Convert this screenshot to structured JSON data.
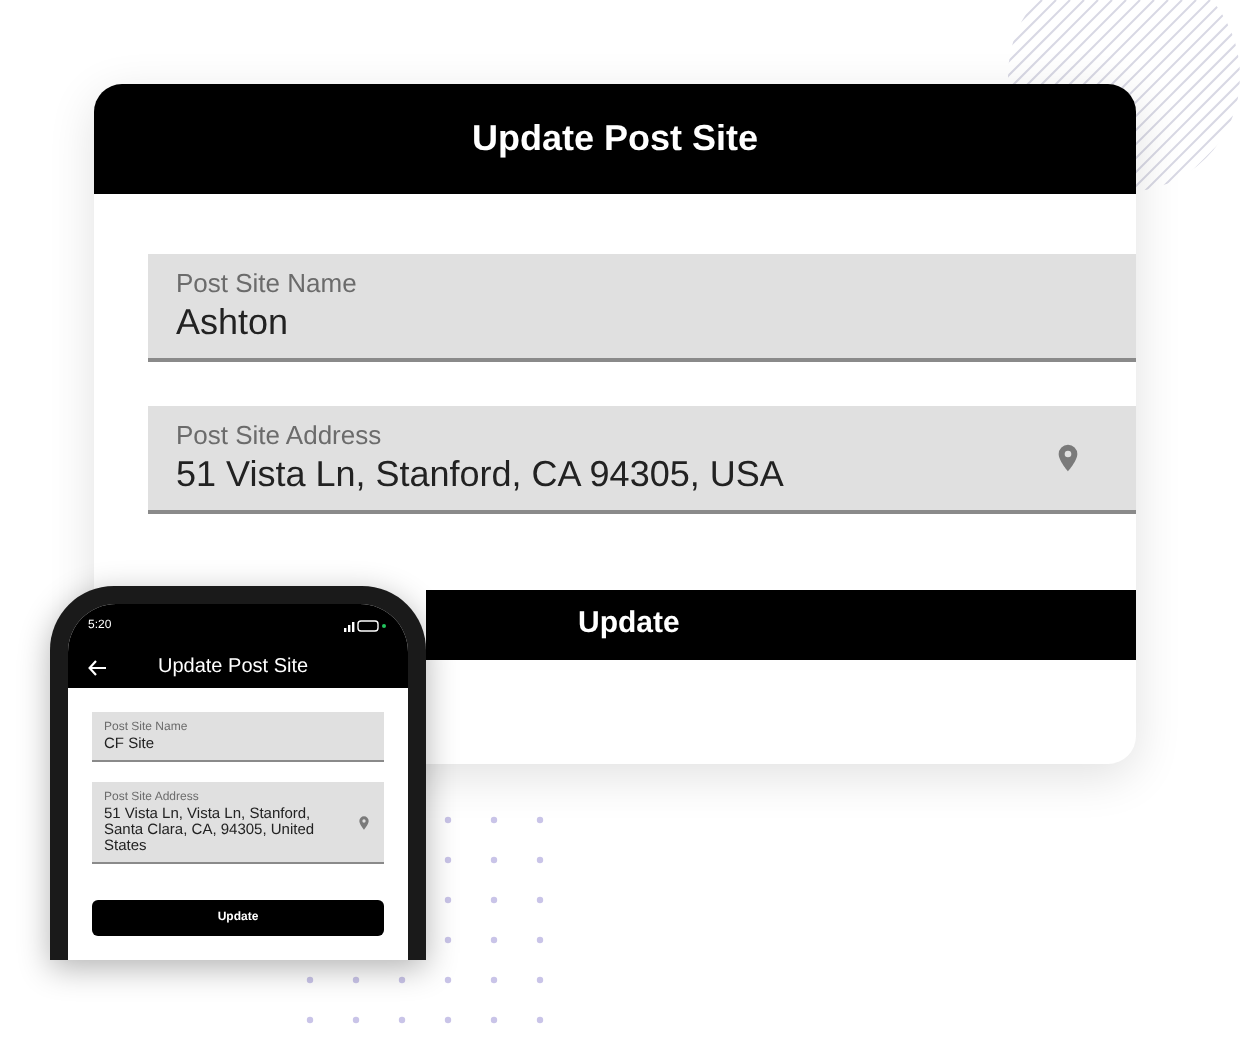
{
  "desktop": {
    "title": "Update Post Site",
    "fields": [
      {
        "kind": "text",
        "label": "Post Site Name",
        "value": "Ashton"
      },
      {
        "kind": "location",
        "label": "Post Site Address",
        "value": "51 Vista Ln, Stanford, CA 94305, USA"
      }
    ],
    "button": "Update"
  },
  "mobile": {
    "time": "5:20",
    "title": "Update Post Site",
    "fields": [
      {
        "kind": "text",
        "label": "Post Site Name",
        "value": "CF Site"
      },
      {
        "kind": "location",
        "label": "Post Site Address",
        "value": "51 Vista Ln, Vista Ln, Stanford, Santa Clara, CA, 94305, United States"
      }
    ],
    "button": "Update"
  }
}
